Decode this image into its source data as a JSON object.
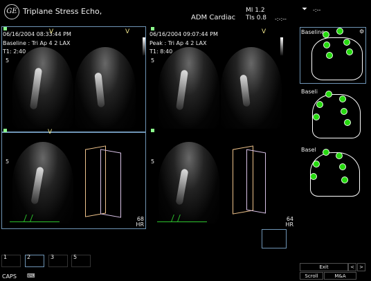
{
  "header": {
    "logo_text": "GE",
    "title": "Triplane Stress Echo,",
    "subtitle": "ADM Cardiac",
    "mi": "MI 1.2",
    "tis": "TIs 0.8",
    "dash": "-:-:--",
    "arrow_symbol": "⏷",
    "right_dash": "-:--"
  },
  "left_panel": {
    "date_time": "06/16/2004 08:33:44 PM",
    "stage": "Baseline : Tri Ap 4 2 LAX",
    "time": "T1: 2:40",
    "top_v_left": "V",
    "top_v_right": "V",
    "lower_v": "V",
    "depth_marker_top": "5",
    "depth_marker_bottom": "5",
    "hr_value": "68",
    "hr_label": "HR"
  },
  "center_panel": {
    "date_time": "06/16/2004 09:07:44 PM",
    "stage": "Peak : Tri Ap 4 2 LAX",
    "time": "T1: 8:40",
    "top_v": "V",
    "depth_marker_top": "5",
    "depth_marker_bottom": "5",
    "hr_value": "64",
    "hr_label": "HR"
  },
  "right_panel": {
    "label_1": "Baseline",
    "label_2": "Baseli",
    "label_3": "Basel"
  },
  "bottom_bar": {
    "thumbnails": [
      "1",
      "2",
      "3",
      "5"
    ],
    "caps": "CAPS",
    "scroll": "Scroll",
    "mode": "M&A",
    "exit": "Exit",
    "prev": "<",
    "next": ">"
  }
}
